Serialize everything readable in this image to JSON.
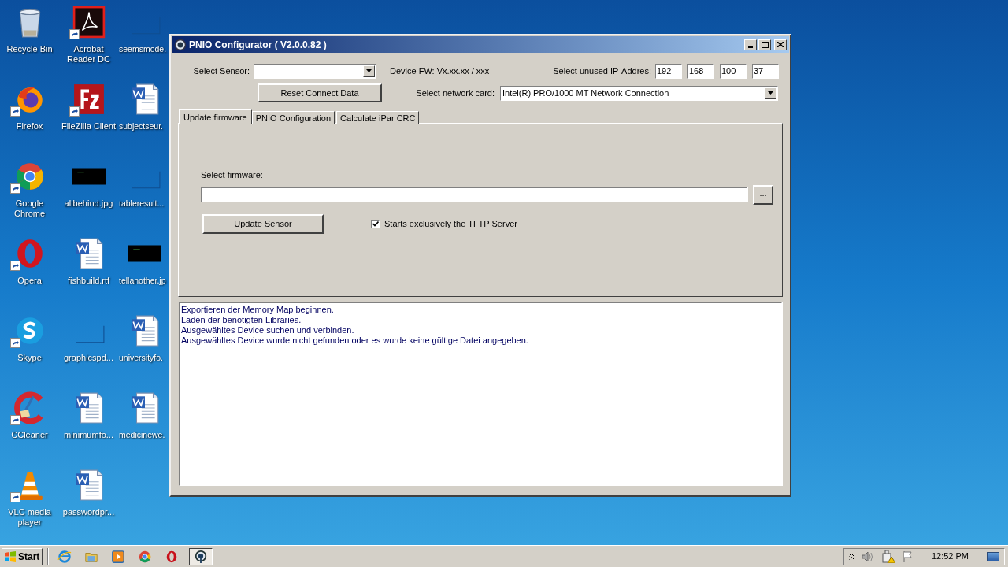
{
  "desktop_icons": [
    {
      "label": "Recycle Bin",
      "kind": "recycle",
      "shortcut": false
    },
    {
      "label": "Firefox",
      "kind": "firefox",
      "shortcut": true
    },
    {
      "label": "Google Chrome",
      "kind": "chrome",
      "shortcut": true
    },
    {
      "label": "Opera",
      "kind": "opera",
      "shortcut": true
    },
    {
      "label": "Skype",
      "kind": "skype",
      "shortcut": true
    },
    {
      "label": "CCleaner",
      "kind": "ccleaner",
      "shortcut": true
    },
    {
      "label": "VLC media player",
      "kind": "vlc",
      "shortcut": true
    },
    {
      "label": "Acrobat Reader DC",
      "kind": "pdf",
      "shortcut": true
    },
    {
      "label": "FileZilla Client",
      "kind": "filezilla",
      "shortcut": true
    },
    {
      "label": "allbehind.jpg",
      "kind": "dark-image",
      "shortcut": false
    },
    {
      "label": "fishbuild.rtf",
      "kind": "word",
      "shortcut": false
    },
    {
      "label": "graphicspd...",
      "kind": "blank",
      "shortcut": false
    },
    {
      "label": "minimumfo...",
      "kind": "word",
      "shortcut": false
    },
    {
      "label": "passwordpr...",
      "kind": "word",
      "shortcut": false
    },
    {
      "label": "seemsmode.",
      "kind": "blank",
      "shortcut": false
    },
    {
      "label": "subjectseur.",
      "kind": "word",
      "shortcut": false
    },
    {
      "label": "tableresult...",
      "kind": "blank",
      "shortcut": false
    },
    {
      "label": "tellanother.jp",
      "kind": "dark-image",
      "shortcut": false
    },
    {
      "label": "universityfo.",
      "kind": "word",
      "shortcut": false
    },
    {
      "label": "medicinewe.",
      "kind": "word",
      "shortcut": false
    }
  ],
  "window": {
    "title": "PNIO Configurator ( V2.0.0.82 )"
  },
  "sensor": {
    "label": "Select Sensor:"
  },
  "device_fw": "Device FW: Vx.xx.xx / xxx",
  "ip": {
    "label": "Select unused IP-Addres:",
    "octets": [
      "192",
      "168",
      "100",
      "37"
    ]
  },
  "reset_button": "Reset Connect Data",
  "network_card": {
    "label": "Select network card:",
    "value": "Intel(R) PRO/1000 MT Network Connection"
  },
  "tabs": [
    {
      "label": "Update firmware",
      "selected": true
    },
    {
      "label": "PNIO Configuration",
      "selected": false
    },
    {
      "label": "Calculate iPar CRC",
      "selected": false
    }
  ],
  "firmware": {
    "label": "Select firmware:",
    "browse_button": "..."
  },
  "update_button": "Update Sensor",
  "tftp_checkbox": {
    "label": "Starts exclusively the TFTP Server",
    "checked": true
  },
  "log": [
    "Exportieren der Memory Map beginnen.",
    "Laden der benötigten Libraries.",
    "Ausgewähltes Device suchen und verbinden.",
    "Ausgewähltes Device wurde nicht gefunden oder es wurde keine gültige Datei angegeben."
  ],
  "taskbar": {
    "start": "Start",
    "apps": [
      {
        "kind": "ie",
        "selected": false
      },
      {
        "kind": "folder",
        "selected": false
      },
      {
        "kind": "media",
        "selected": false
      },
      {
        "kind": "chrome",
        "selected": false
      },
      {
        "kind": "opera",
        "selected": false
      },
      {
        "kind": "pnio",
        "selected": true
      }
    ],
    "clock": "12:52 PM"
  }
}
